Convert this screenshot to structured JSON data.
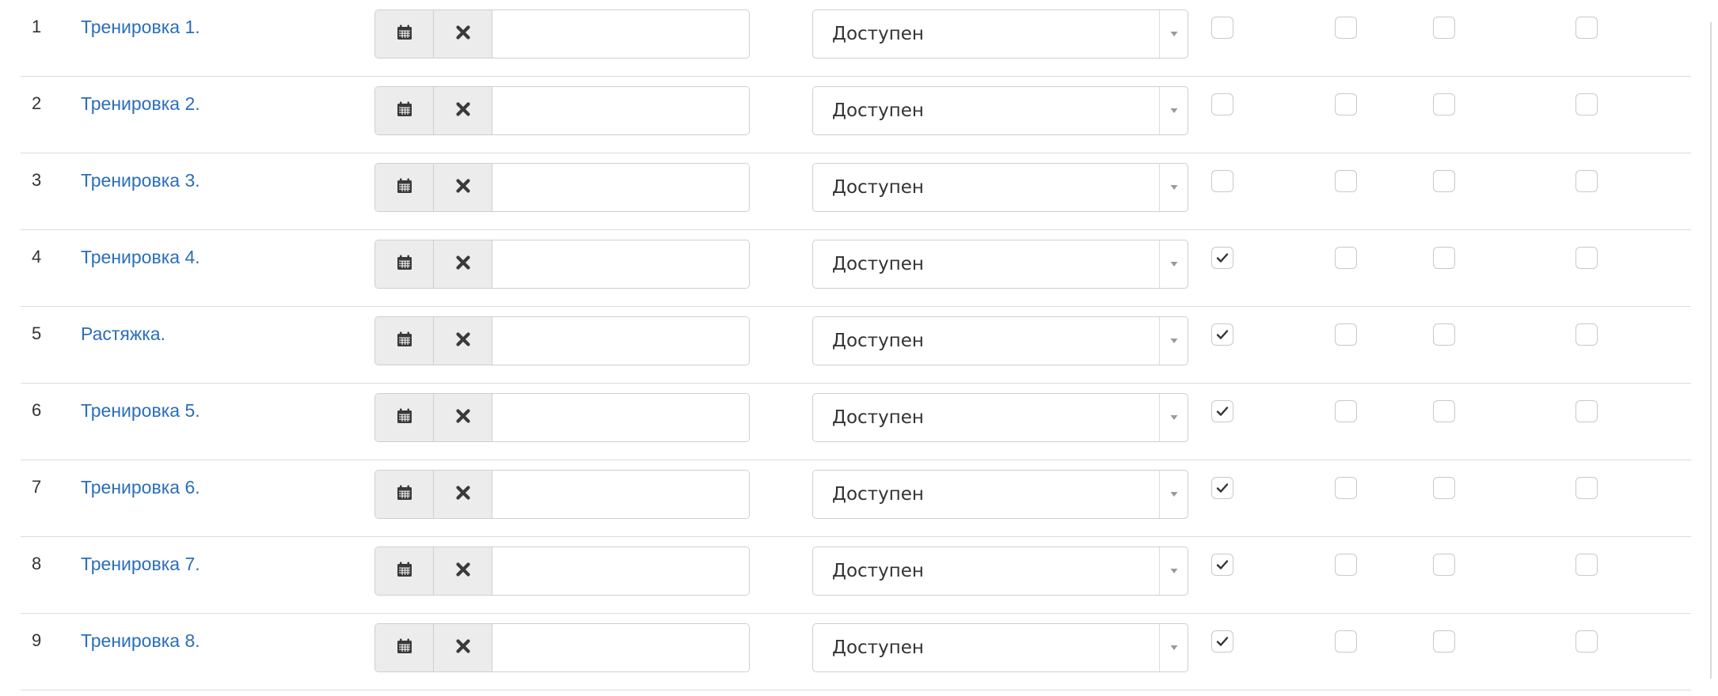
{
  "status_options": [
    "Доступен"
  ],
  "rows": [
    {
      "num": "1",
      "title": "Тренировка 1.",
      "date": "",
      "status": "Доступен",
      "checks": [
        false,
        false,
        false,
        false
      ]
    },
    {
      "num": "2",
      "title": "Тренировка 2.",
      "date": "",
      "status": "Доступен",
      "checks": [
        false,
        false,
        false,
        false
      ]
    },
    {
      "num": "3",
      "title": "Тренировка 3.",
      "date": "",
      "status": "Доступен",
      "checks": [
        false,
        false,
        false,
        false
      ]
    },
    {
      "num": "4",
      "title": "Тренировка 4.",
      "date": "",
      "status": "Доступен",
      "checks": [
        true,
        false,
        false,
        false
      ]
    },
    {
      "num": "5",
      "title": "Растяжка.",
      "date": "",
      "status": "Доступен",
      "checks": [
        true,
        false,
        false,
        false
      ]
    },
    {
      "num": "6",
      "title": "Тренировка 5.",
      "date": "",
      "status": "Доступен",
      "checks": [
        true,
        false,
        false,
        false
      ]
    },
    {
      "num": "7",
      "title": "Тренировка 6.",
      "date": "",
      "status": "Доступен",
      "checks": [
        true,
        false,
        false,
        false
      ]
    },
    {
      "num": "8",
      "title": "Тренировка 7.",
      "date": "",
      "status": "Доступен",
      "checks": [
        true,
        false,
        false,
        false
      ]
    },
    {
      "num": "9",
      "title": "Тренировка 8.",
      "date": "",
      "status": "Доступен",
      "checks": [
        true,
        false,
        false,
        false
      ]
    }
  ],
  "colors": {
    "link": "#2a6ebb",
    "border": "#cfcfcf",
    "addon_bg": "#ececec",
    "divider": "#dcdcdc"
  },
  "icons": {
    "calendar": "calendar-icon",
    "clear": "close-icon",
    "dropdown": "caret-down-icon",
    "check": "checkmark-icon"
  }
}
